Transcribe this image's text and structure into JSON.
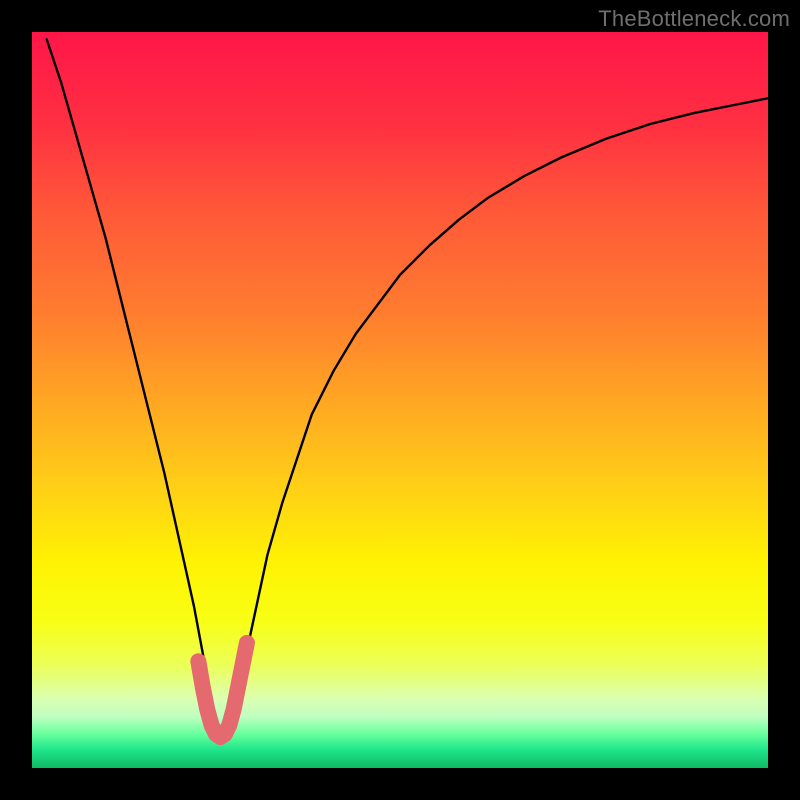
{
  "watermark": "TheBottleneck.com",
  "chart_data": {
    "type": "line",
    "title": "",
    "xlabel": "",
    "ylabel": "",
    "xlim": [
      0,
      100
    ],
    "ylim": [
      0,
      100
    ],
    "background": {
      "type": "vertical-gradient",
      "stops": [
        {
          "offset": 0.0,
          "color": "#ff1648"
        },
        {
          "offset": 0.12,
          "color": "#ff2e42"
        },
        {
          "offset": 0.25,
          "color": "#ff5a38"
        },
        {
          "offset": 0.38,
          "color": "#ff7c2f"
        },
        {
          "offset": 0.5,
          "color": "#ffa623"
        },
        {
          "offset": 0.62,
          "color": "#ffd016"
        },
        {
          "offset": 0.72,
          "color": "#fff203"
        },
        {
          "offset": 0.8,
          "color": "#f8ff14"
        },
        {
          "offset": 0.86,
          "color": "#ecff58"
        },
        {
          "offset": 0.905,
          "color": "#dcffb0"
        },
        {
          "offset": 0.93,
          "color": "#c0ffc0"
        },
        {
          "offset": 0.955,
          "color": "#64ff9c"
        },
        {
          "offset": 0.975,
          "color": "#20e58a"
        },
        {
          "offset": 1.0,
          "color": "#0fba62"
        }
      ]
    },
    "series": [
      {
        "name": "bottleneck-curve",
        "color": "#000000",
        "x": [
          2,
          4,
          6,
          8,
          10,
          12,
          14,
          16,
          18,
          20,
          22,
          23.5,
          24.4,
          25.2,
          26.0,
          26.8,
          27.6,
          29.0,
          30.5,
          32,
          34,
          36,
          38,
          41,
          44,
          47,
          50,
          54,
          58,
          62,
          67,
          72,
          78,
          84,
          90,
          96,
          100
        ],
        "y": [
          99,
          93,
          86,
          79,
          72,
          64,
          56,
          48,
          40,
          31,
          22,
          14,
          8.5,
          5.0,
          4.0,
          5.0,
          8.5,
          15,
          22,
          29,
          36,
          42,
          48,
          54,
          59,
          63,
          67,
          71,
          74.5,
          77.5,
          80.5,
          83,
          85.5,
          87.5,
          89,
          90.2,
          91
        ]
      }
    ],
    "valley_marker": {
      "color": "#e46a6f",
      "x": [
        22.6,
        23.2,
        23.8,
        24.4,
        25.0,
        25.6,
        26.2,
        26.8,
        27.4,
        28.0,
        28.6,
        29.2
      ],
      "y": [
        14.5,
        11.0,
        8.0,
        5.8,
        4.6,
        4.2,
        4.6,
        5.8,
        8.0,
        11.0,
        14.0,
        17.0
      ]
    }
  }
}
